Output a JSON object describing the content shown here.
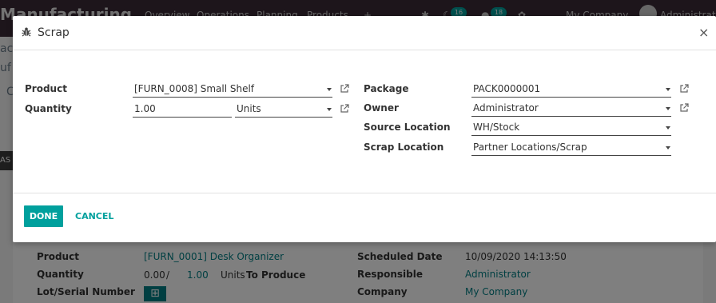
{
  "navbar": {
    "app_name": "Manufacturing",
    "menu": [
      "Overview",
      "Operations",
      "Planning",
      "Products",
      "+"
    ],
    "chat_count": "16",
    "activity_count": "18",
    "company": "My Company",
    "user": "Administrator"
  },
  "background": {
    "left_fragments": [
      "ac",
      "uf",
      "C"
    ],
    "tag": "AS",
    "fields": {
      "product_label": "Product",
      "product_value": "[FURN_0001] Desk Organizer",
      "quantity_label": "Quantity",
      "quantity_done": "0.00",
      "quantity_sep": "/",
      "quantity_total": "1.00",
      "quantity_units": "Units",
      "quantity_suffix": "To Produce",
      "lot_label": "Lot/Serial Number",
      "lot_add": "⊞",
      "scheduled_label": "Scheduled Date",
      "scheduled_value": "10/09/2020 14:13:50",
      "responsible_label": "Responsible",
      "responsible_value": "Administrator",
      "company_label": "Company",
      "company_value": "My Company"
    }
  },
  "dialog": {
    "title": "Scrap",
    "icons": {
      "title": "bug-icon",
      "close": "close-icon",
      "external": "external-link-icon",
      "dropdown": "caret-down-icon"
    },
    "close_glyph": "×",
    "left": {
      "product_label": "Product",
      "product_value": "[FURN_0008] Small Shelf",
      "quantity_label": "Quantity",
      "quantity_value": "1.00",
      "uom_value": "Units"
    },
    "right": {
      "package_label": "Package",
      "package_value": "PACK0000001",
      "owner_label": "Owner",
      "owner_value": "Administrator",
      "source_label": "Source Location",
      "source_value": "WH/Stock",
      "scrap_label": "Scrap Location",
      "scrap_value": "Partner Locations/Scrap"
    },
    "footer": {
      "done_label": "DONE",
      "cancel_label": "CANCEL"
    },
    "colors": {
      "primary": "#00a09d",
      "link": "#017e84",
      "navbar": "#3b2b36"
    }
  }
}
